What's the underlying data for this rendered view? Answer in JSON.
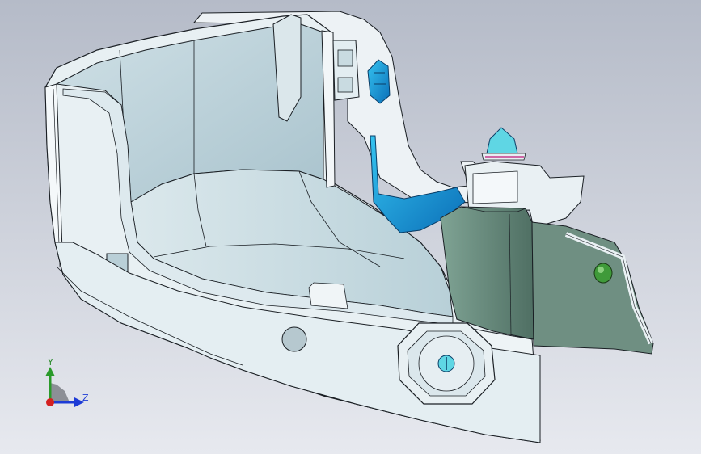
{
  "viewport": {
    "background_top": "#b7bdca",
    "background_bottom": "#e6e8ee",
    "part_face_light": "#e9f1f4",
    "part_face_mid": "#bcd3dc",
    "part_face_shadow": "#8fa8b3",
    "part_dark_green": "#6f8f82",
    "edge_color": "#1a1f24",
    "clip_blue": "#19a6e0",
    "clip_cyan": "#55d8e6",
    "pin_green": "#3f9a3a",
    "magenta_accent": "#c0187a"
  },
  "triad": {
    "y_label": "Y",
    "z_label": "Z",
    "y_color": "#2a9a2a",
    "z_color": "#1d3bd6",
    "x_color": "#d42020"
  }
}
